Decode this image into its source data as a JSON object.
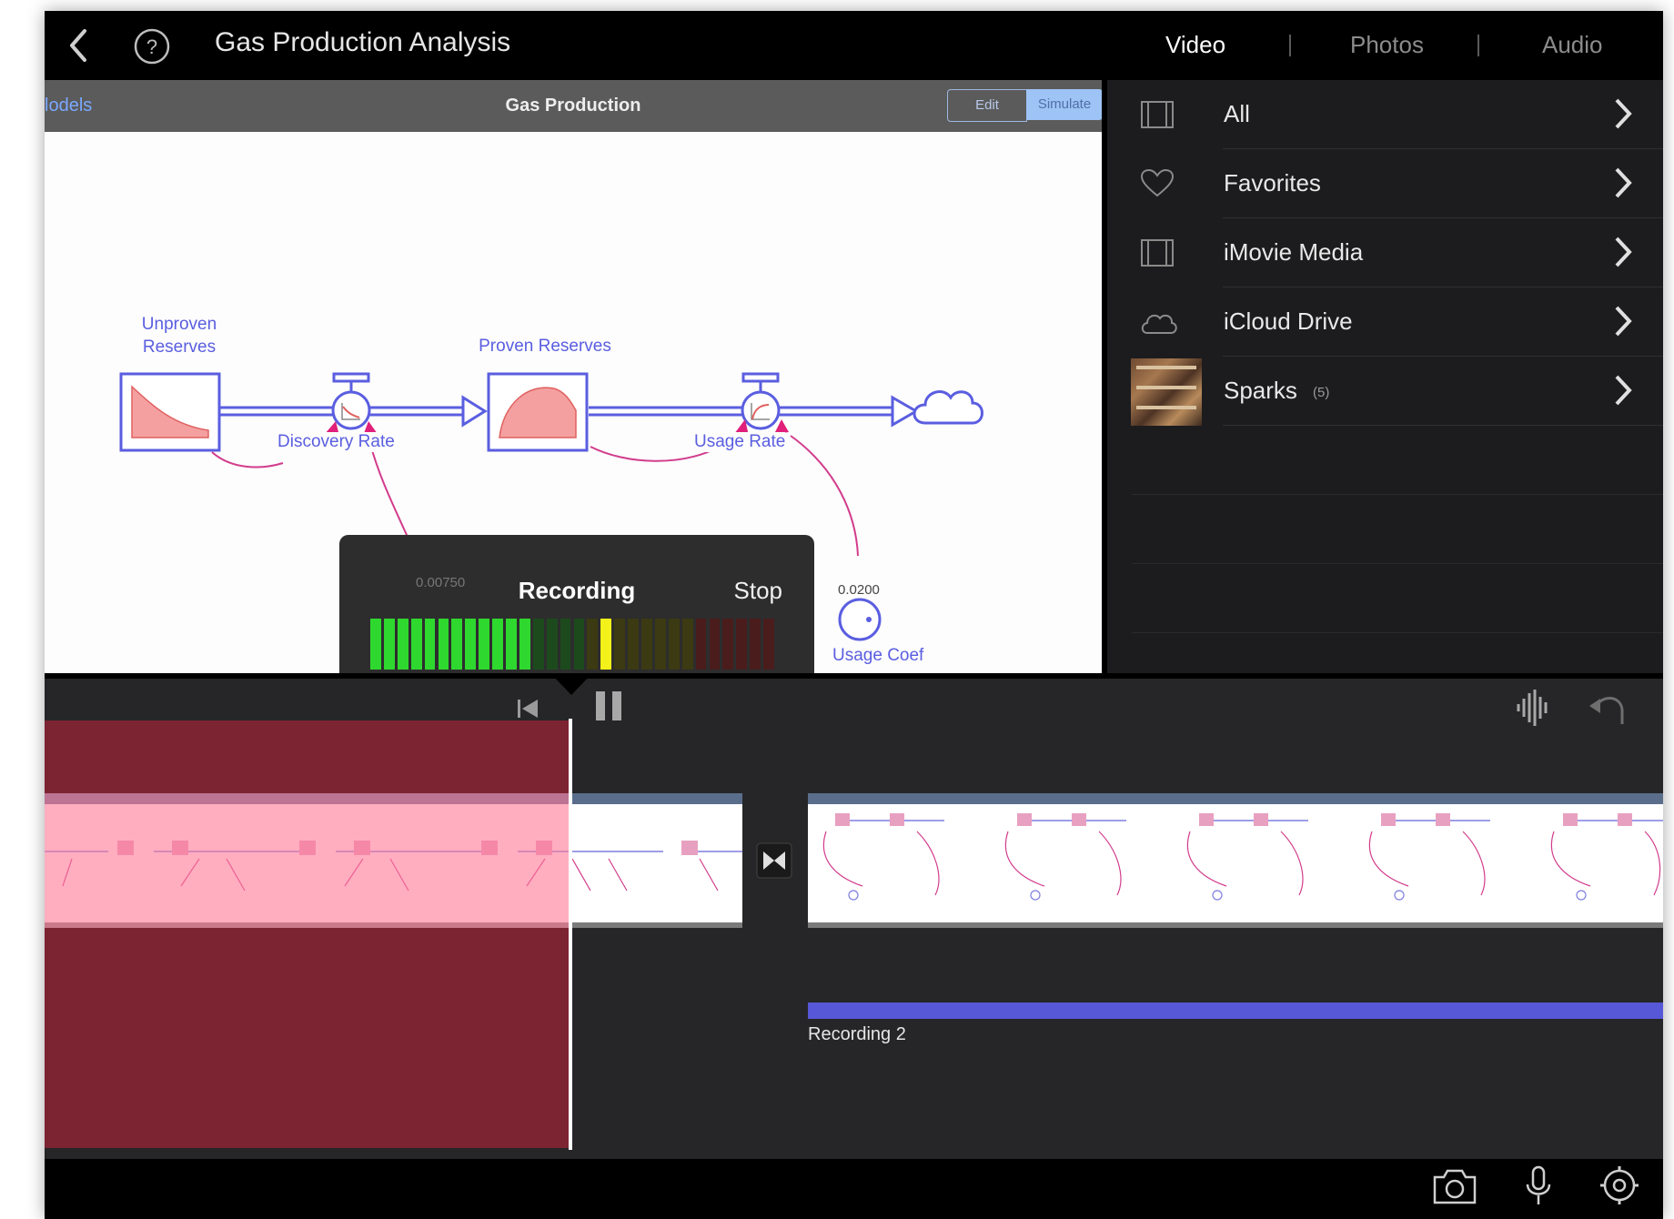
{
  "header": {
    "title": "Gas Production Analysis",
    "tabs": [
      {
        "label": "Video",
        "active": true
      },
      {
        "label": "Photos",
        "active": false
      },
      {
        "label": "Audio",
        "active": false
      }
    ]
  },
  "model": {
    "back_label": "lodels",
    "title": "Gas Production",
    "edit_label": "Edit",
    "simulate_label": "Simulate",
    "unproven_reserves": "Unproven Reserves",
    "proven_reserves": "Proven Reserves",
    "discovery_rate": "Discovery Rate",
    "usage_rate": "Usage Rate",
    "usage_coef": "Usage Coef",
    "usage_coef_value": "0.0200",
    "discovery_coef_value": "0.00750"
  },
  "library": {
    "items": [
      {
        "label": "All",
        "icon": "film-icon",
        "count": ""
      },
      {
        "label": "Favorites",
        "icon": "heart-icon",
        "count": ""
      },
      {
        "label": "iMovie Media",
        "icon": "film-icon",
        "count": ""
      },
      {
        "label": "iCloud Drive",
        "icon": "cloud-icon",
        "count": ""
      },
      {
        "label": "Sparks",
        "icon": "thumbnail",
        "count": "(5)"
      }
    ]
  },
  "recording": {
    "title": "Recording",
    "stop_label": "Stop",
    "level_meter": {
      "segments": 30,
      "active_green": 12,
      "peak_index": 17
    }
  },
  "timeline": {
    "audio_clip_label": "Recording 2"
  },
  "colors": {
    "accent_blue": "#5658d8",
    "recorded_region": "#7d2433",
    "model_link": "#d23c8c",
    "stock_fill": "#f4a0a0"
  }
}
